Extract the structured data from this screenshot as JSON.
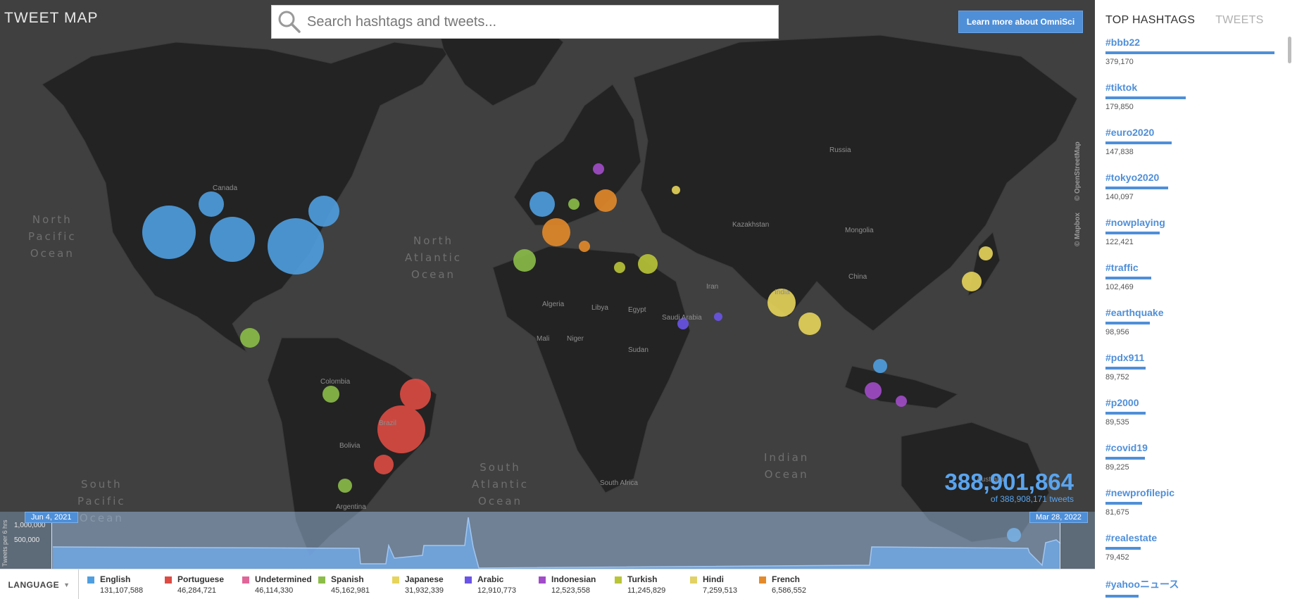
{
  "app": {
    "title": "TWEET MAP"
  },
  "search": {
    "placeholder": "Search hashtags and tweets..."
  },
  "header": {
    "learn_more_label": "Learn more about OmniSci"
  },
  "map": {
    "attribution": [
      "© Mapbox",
      "© OpenStreetMap"
    ],
    "oceans": [
      {
        "name": "North\nPacific\nOcean"
      },
      {
        "name": "North\nAtlantic\nOcean"
      },
      {
        "name": "South\nPacific\nOcean"
      },
      {
        "name": "South\nAtlantic\nOcean"
      },
      {
        "name": "Indian\nOcean"
      }
    ],
    "countries": [
      "Canada",
      "Russia",
      "Kazakhstan",
      "Mongolia",
      "China",
      "Iran",
      "Saudi Arabia",
      "Egypt",
      "Libya",
      "Algeria",
      "Mali",
      "Niger",
      "Sudan",
      "Brazil",
      "Bolivia",
      "Argentina",
      "Colombia",
      "South Africa",
      "Australia",
      "India"
    ],
    "colors": {
      "land": "#232323",
      "water": "#404040"
    }
  },
  "counter": {
    "shown": "388,901,864",
    "total_text": "of 388,908,171 tweets"
  },
  "timeline": {
    "y_axis_label": "Tweets per 6 hrs",
    "ticks": [
      "1,000,000",
      "500,000"
    ],
    "start_date": "Jun 4, 2021",
    "end_date": "Mar 28, 2022"
  },
  "legend": {
    "dropdown_label": "LANGUAGE",
    "items": [
      {
        "name": "English",
        "count": "131,107,588",
        "color": "#4f9fe0"
      },
      {
        "name": "Portuguese",
        "count": "46,284,721",
        "color": "#dd4b43"
      },
      {
        "name": "Undetermined",
        "count": "46,114,330",
        "color": "#e06699"
      },
      {
        "name": "Spanish",
        "count": "45,162,981",
        "color": "#8bbd48"
      },
      {
        "name": "Japanese",
        "count": "31,932,339",
        "color": "#e7d45a"
      },
      {
        "name": "Arabic",
        "count": "12,910,773",
        "color": "#6a54e8"
      },
      {
        "name": "Indonesian",
        "count": "12,523,558",
        "color": "#a24cc9"
      },
      {
        "name": "Turkish",
        "count": "11,245,829",
        "color": "#b9c437"
      },
      {
        "name": "Hindi",
        "count": "7,259,513",
        "color": "#e2d164"
      },
      {
        "name": "French",
        "count": "6,586,552",
        "color": "#e48a2a"
      }
    ]
  },
  "panel": {
    "tabs": [
      {
        "label": "TOP HASHTAGS",
        "active": true
      },
      {
        "label": "TWEETS",
        "active": false
      }
    ],
    "hashtags": [
      {
        "tag": "#bbb22",
        "count": "379,170",
        "value": 379170
      },
      {
        "tag": "#tiktok",
        "count": "179,850",
        "value": 179850
      },
      {
        "tag": "#euro2020",
        "count": "147,838",
        "value": 147838
      },
      {
        "tag": "#tokyo2020",
        "count": "140,097",
        "value": 140097
      },
      {
        "tag": "#nowplaying",
        "count": "122,421",
        "value": 122421
      },
      {
        "tag": "#traffic",
        "count": "102,469",
        "value": 102469
      },
      {
        "tag": "#earthquake",
        "count": "98,956",
        "value": 98956
      },
      {
        "tag": "#pdx911",
        "count": "89,752",
        "value": 89752
      },
      {
        "tag": "#p2000",
        "count": "89,535",
        "value": 89535
      },
      {
        "tag": "#covid19",
        "count": "89,225",
        "value": 89225
      },
      {
        "tag": "#newprofilepic",
        "count": "81,675",
        "value": 81675
      },
      {
        "tag": "#realestate",
        "count": "79,452",
        "value": 79452
      },
      {
        "tag": "#yahooニュース",
        "count": "",
        "value": 75000
      }
    ]
  }
}
